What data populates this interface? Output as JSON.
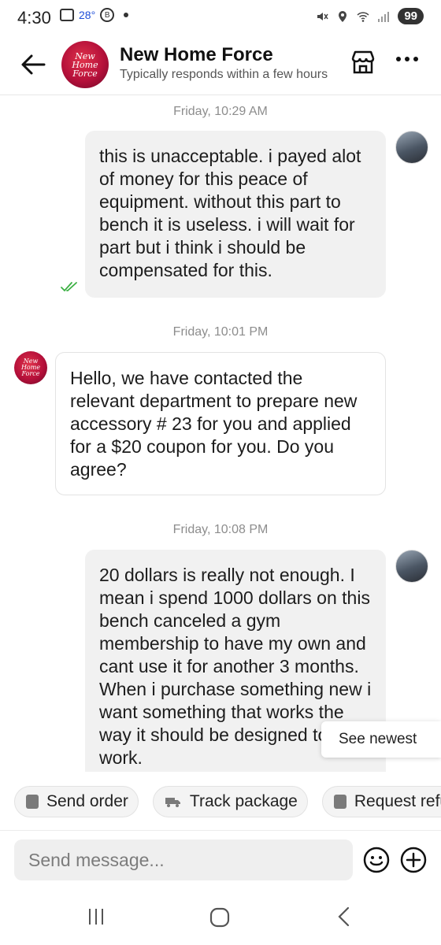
{
  "status_bar": {
    "time": "4:30",
    "temperature": "28°",
    "battery": "99"
  },
  "header": {
    "shop_name": "New Home Force",
    "response_time": "Typically responds within a few hours",
    "avatar_text_line1": "New Home",
    "avatar_text_line2": "Force"
  },
  "messages": [
    {
      "timestamp": "Friday, 10:29 AM",
      "sender": "user",
      "text": "this is unacceptable. i payed alot of money for this peace of equipment. without this part to bench it is useless. i will wait for part but i think i should be compensated for this."
    },
    {
      "timestamp": "Friday, 10:01 PM",
      "sender": "shop",
      "text": "Hello, we have contacted the relevant department to prepare new accessory # 23 for you and applied for a $20 coupon for you. Do you agree?"
    },
    {
      "timestamp": "Friday, 10:08 PM",
      "sender": "user",
      "text": "20 dollars is really not enough. I mean i spend 1000 dollars on this bench canceled a gym membership to have my own and cant use it for another 3 months. When i purchase something new i want something that works the way it should be designed to work."
    }
  ],
  "see_newest": "See newest",
  "quick_replies": [
    {
      "label": "Send order",
      "icon": "document-icon"
    },
    {
      "label": "Track package",
      "icon": "truck-icon"
    },
    {
      "label": "Request refu",
      "icon": "wallet-icon"
    }
  ],
  "composer": {
    "placeholder": "Send message..."
  },
  "colors": {
    "accent": "#b5103a",
    "out_bubble": "#f1f1f1",
    "seen": "#3cb043"
  }
}
